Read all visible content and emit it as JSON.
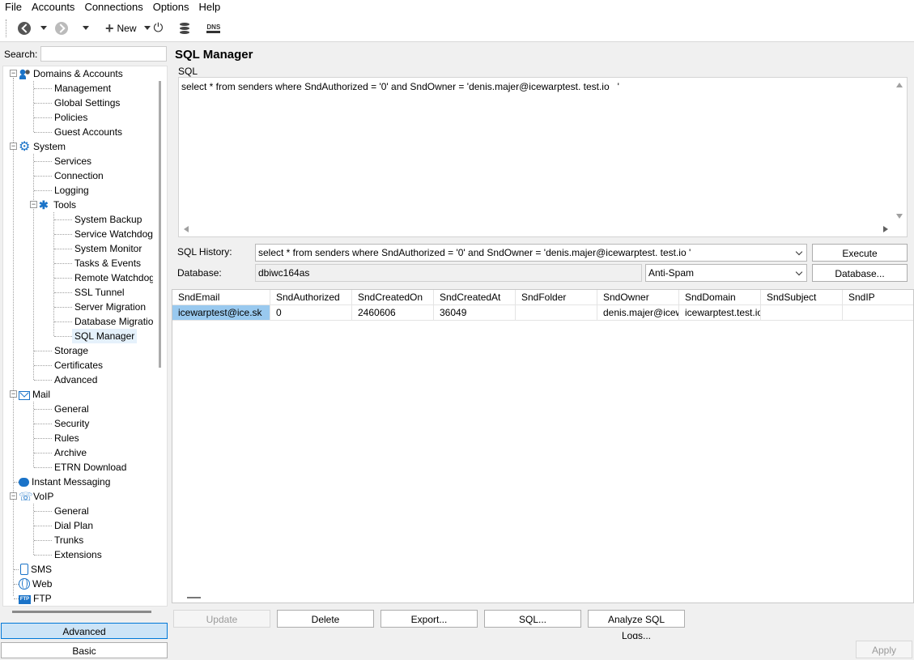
{
  "menu": [
    "File",
    "Accounts",
    "Connections",
    "Options",
    "Help"
  ],
  "toolbar": {
    "back_icon": "back-icon",
    "forward_icon": "forward-icon",
    "new_label": "New",
    "dns_label": "DNS"
  },
  "search": {
    "label": "Search:",
    "value": ""
  },
  "tree": {
    "domains_accounts": "Domains & Accounts",
    "management": "Management",
    "global_settings": "Global Settings",
    "policies": "Policies",
    "guest_accounts": "Guest Accounts",
    "system": "System",
    "services": "Services",
    "connection": "Connection",
    "logging": "Logging",
    "tools": "Tools",
    "system_backup": "System Backup",
    "service_watchdog": "Service Watchdog",
    "system_monitor": "System Monitor",
    "tasks_events": "Tasks & Events",
    "remote_watchdog": "Remote Watchdog",
    "ssl_tunnel": "SSL Tunnel",
    "server_migration": "Server Migration",
    "database_migration": "Database Migration",
    "sql_manager": "SQL Manager",
    "storage": "Storage",
    "certificates": "Certificates",
    "advanced": "Advanced",
    "mail": "Mail",
    "mail_general": "General",
    "security": "Security",
    "rules": "Rules",
    "archive": "Archive",
    "etrn_download": "ETRN Download",
    "instant_messaging": "Instant Messaging",
    "voip": "VoIP",
    "voip_general": "General",
    "dial_plan": "Dial Plan",
    "trunks": "Trunks",
    "extensions": "Extensions",
    "sms": "SMS",
    "web": "Web",
    "ftp": "FTP",
    "ftp_badge": "FTP"
  },
  "mode": {
    "advanced": "Advanced",
    "basic": "Basic"
  },
  "main": {
    "title": "SQL Manager",
    "sql_label": "SQL",
    "sql_text": "select * from senders where SndAuthorized = '0' and SndOwner = 'denis.majer@icewarptest. test.io   '",
    "history_label": "SQL History:",
    "history_value": "select * from senders where SndAuthorized = '0' and SndOwner = 'denis.majer@icewarptest. test.io  '",
    "execute": "Execute",
    "database_label": "Database:",
    "database_value": "dbiwc164as",
    "db_select": "Anti-Spam",
    "database_button": "Database..."
  },
  "grid": {
    "columns": [
      "SndEmail",
      "SndAuthorized",
      "SndCreatedOn",
      "SndCreatedAt",
      "SndFolder",
      "SndOwner",
      "SndDomain",
      "SndSubject",
      "SndIP"
    ],
    "rows": [
      [
        "icewarptest@ice.sk",
        "0",
        "2460606",
        "36049",
        "",
        "denis.majer@icewar",
        "icewarptest.test.io",
        "",
        ""
      ]
    ]
  },
  "actions": {
    "update": "Update",
    "delete": "Delete",
    "export": "Export...",
    "sql": "SQL...",
    "analyze": "Analyze SQL Logs...",
    "apply": "Apply"
  }
}
